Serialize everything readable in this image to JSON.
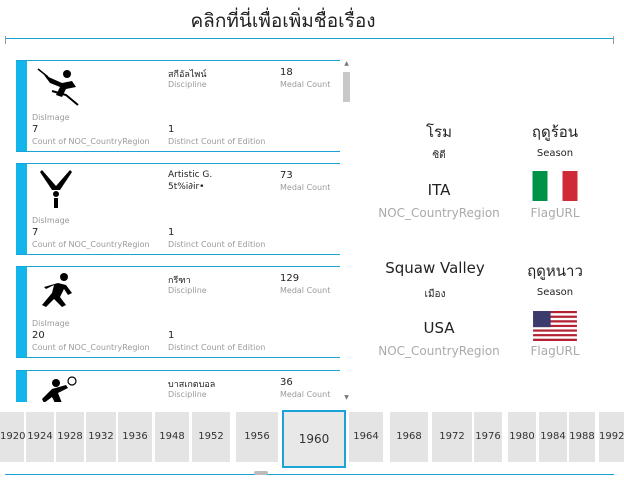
{
  "title": "คลิกที่นี่เพื่อเพิ่มชื่อเรื่อง",
  "cards": [
    {
      "icon": "skiing-pictogram-icon",
      "discipline_value": "สกีอัลไพน์",
      "discipline_label": "Discipline",
      "medal_value": "18",
      "medal_label": "Medal Count",
      "img_label": "DisImage",
      "count_value": "7",
      "count_label": "Count of NOC_CountryRegion",
      "edition_value": "1",
      "edition_label": "Distinct Count of Edition"
    },
    {
      "icon": "gymnastics-pictogram-icon",
      "discipline_value": "Artistic G.",
      "discipline_value2": "5t%i∂ir•",
      "discipline_label": "",
      "medal_value": "73",
      "medal_label": "Medal Count",
      "img_label": "DisImage",
      "count_value": "7",
      "count_label": "Count of NOC_CountryRegion",
      "edition_value": "1",
      "edition_label": "Distinct Count of Edition"
    },
    {
      "icon": "athletics-pictogram-icon",
      "discipline_value": "กรีฑา",
      "discipline_label": "Discipline",
      "medal_value": "129",
      "medal_label": "Medal Count",
      "img_label": "DisImage",
      "count_value": "20",
      "count_label": "Count of NOC_CountryRegion",
      "edition_value": "1",
      "edition_label": "Distinct Count of Edition"
    },
    {
      "icon": "volleyball-pictogram-icon",
      "discipline_value": "บาสเกตบอล",
      "discipline_label": "Discipline",
      "medal_value": "36",
      "medal_label": "Medal Count"
    }
  ],
  "summer": {
    "city": "โรม",
    "season_value": "ฤดูร้อน",
    "season_small": "ซิตี",
    "season_label": "Season",
    "noc": "ITA",
    "noc_label": "NOC_CountryRegion",
    "flag_label": "FlagURL",
    "flag_colors": [
      "#009246",
      "#ffffff",
      "#ce2b37"
    ]
  },
  "winter": {
    "city": "Squaw Valley",
    "season_value": "ฤดูหนาว",
    "season_small": "เมือง",
    "season_label": "Season",
    "noc": "USA",
    "noc_label": "NOC_CountryRegion",
    "flag_label": "FlagURL",
    "flag_colors": [
      "#b22234",
      "#ffffff",
      "#3c3b6e"
    ]
  },
  "timeline": {
    "years": [
      "1920",
      "1924",
      "1928",
      "1932",
      "1936",
      "1948",
      "1952",
      "1956",
      "1960",
      "1964",
      "1968",
      "1972",
      "1976",
      "1980",
      "1984",
      "1988",
      "1992"
    ],
    "selected": "1960"
  }
}
